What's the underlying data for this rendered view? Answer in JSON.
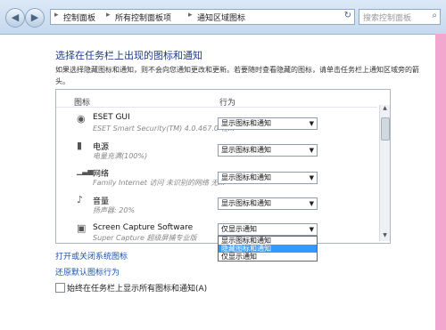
{
  "nav": {
    "back": "◀",
    "forward": "▶",
    "breadcrumbs": [
      "控制面板",
      "所有控制面板项",
      "通知区域图标"
    ],
    "separator": "▸",
    "refresh": "↻",
    "search_placeholder": "搜索控制面板",
    "search_icon": "⌕"
  },
  "page": {
    "title": "选择在任务栏上出现的图标和通知",
    "description": "如果选择隐藏图标和通知，则不会向您通知更改和更新。若要随时查看隐藏的图标，请单击任务栏上通知区域旁的箭头。"
  },
  "table": {
    "header_icon": "图标",
    "header_behavior": "行为",
    "rows": [
      {
        "icon": "◉",
        "name": "ESET GUI",
        "desc": "ESET Smart Security(TM) 4.0.467.0 程...",
        "behavior": "显示图标和通知"
      },
      {
        "icon": "▮",
        "name": "电源",
        "desc": "电量充满(100%)",
        "behavior": "显示图标和通知"
      },
      {
        "icon": "▁▃▅",
        "name": "网络",
        "desc": "Family Internet 访问 未识别的网络 无...",
        "behavior": "显示图标和通知"
      },
      {
        "icon": "♪",
        "name": "音量",
        "desc": "扬声器: 20%",
        "behavior": "显示图标和通知"
      },
      {
        "icon": "▣",
        "name": "Screen Capture Software",
        "desc": "Super Capture 超级屏捕专业版",
        "behavior": "仅显示通知"
      }
    ],
    "arrow": "▼",
    "dropdown_options": [
      "显示图标和通知",
      "隐藏图标和通知",
      "仅显示通知"
    ],
    "dropdown_highlight_index": 1
  },
  "scrollbar": {
    "up": "▲",
    "down": "▼"
  },
  "links": {
    "system_icons": "打开或关闭系统图标",
    "restore_default": "还原默认图标行为"
  },
  "checkbox": {
    "label": "始终在任务栏上显示所有图标和通知(A)",
    "checked": false
  }
}
